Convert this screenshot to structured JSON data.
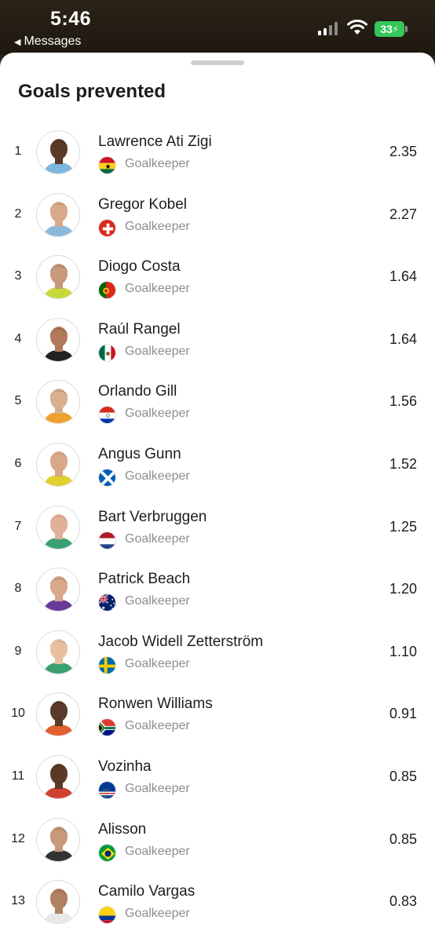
{
  "status": {
    "time": "5:46",
    "back_label": "Messages",
    "battery": "33"
  },
  "sheet": {
    "title": "Goals prevented"
  },
  "players": [
    {
      "rank": "1",
      "name": "Lawrence Ati Zigi",
      "position": "Goalkeeper",
      "value": "2.35",
      "flag": "ghana",
      "kit": "#7fb6e0",
      "skin": "#5a3a26",
      "hair": "#1d1410"
    },
    {
      "rank": "2",
      "name": "Gregor Kobel",
      "position": "Goalkeeper",
      "value": "2.27",
      "flag": "switzerland",
      "kit": "#8cb8dc",
      "skin": "#d9a98a",
      "hair": "#5a4030"
    },
    {
      "rank": "3",
      "name": "Diogo Costa",
      "position": "Goalkeeper",
      "value": "1.64",
      "flag": "portugal",
      "kit": "#c8d83a",
      "skin": "#c8987a",
      "hair": "#2a1f18"
    },
    {
      "rank": "4",
      "name": "Raúl Rangel",
      "position": "Goalkeeper",
      "value": "1.64",
      "flag": "mexico",
      "kit": "#222222",
      "skin": "#b07a5a",
      "hair": "#1a1410"
    },
    {
      "rank": "5",
      "name": "Orlando Gill",
      "position": "Goalkeeper",
      "value": "1.56",
      "flag": "paraguay",
      "kit": "#f0a030",
      "skin": "#d8b090",
      "hair": "#3a2a20"
    },
    {
      "rank": "6",
      "name": "Angus Gunn",
      "position": "Goalkeeper",
      "value": "1.52",
      "flag": "scotland",
      "kit": "#e0d030",
      "skin": "#d8a888",
      "hair": "#6a4a30"
    },
    {
      "rank": "7",
      "name": "Bart Verbruggen",
      "position": "Goalkeeper",
      "value": "1.25",
      "flag": "netherlands",
      "kit": "#3aa070",
      "skin": "#e0b098",
      "hair": "#7a5a40"
    },
    {
      "rank": "8",
      "name": "Patrick Beach",
      "position": "Goalkeeper",
      "value": "1.20",
      "flag": "australia",
      "kit": "#6a3a9a",
      "skin": "#d8a888",
      "hair": "#2a1a14"
    },
    {
      "rank": "9",
      "name": "Jacob Widell Zetterström",
      "position": "Goalkeeper",
      "value": "1.10",
      "flag": "sweden",
      "kit": "#3aa070",
      "skin": "#e8c0a0",
      "hair": "#8a6040"
    },
    {
      "rank": "10",
      "name": "Ronwen Williams",
      "position": "Goalkeeper",
      "value": "0.91",
      "flag": "southafrica",
      "kit": "#e06030",
      "skin": "#5a3a2a",
      "hair": "#1a1410"
    },
    {
      "rank": "11",
      "name": "Vozinha",
      "position": "Goalkeeper",
      "value": "0.85",
      "flag": "capeverde",
      "kit": "#d04030",
      "skin": "#5a3a26",
      "hair": "#1a1410"
    },
    {
      "rank": "12",
      "name": "Alisson",
      "position": "Goalkeeper",
      "value": "0.85",
      "flag": "brazil",
      "kit": "#333333",
      "skin": "#c8987a",
      "hair": "#4a3020"
    },
    {
      "rank": "13",
      "name": "Camilo Vargas",
      "position": "Goalkeeper",
      "value": "0.83",
      "flag": "colombia",
      "kit": "#e8e8e8",
      "skin": "#b08060",
      "hair": "#1a1410"
    }
  ]
}
